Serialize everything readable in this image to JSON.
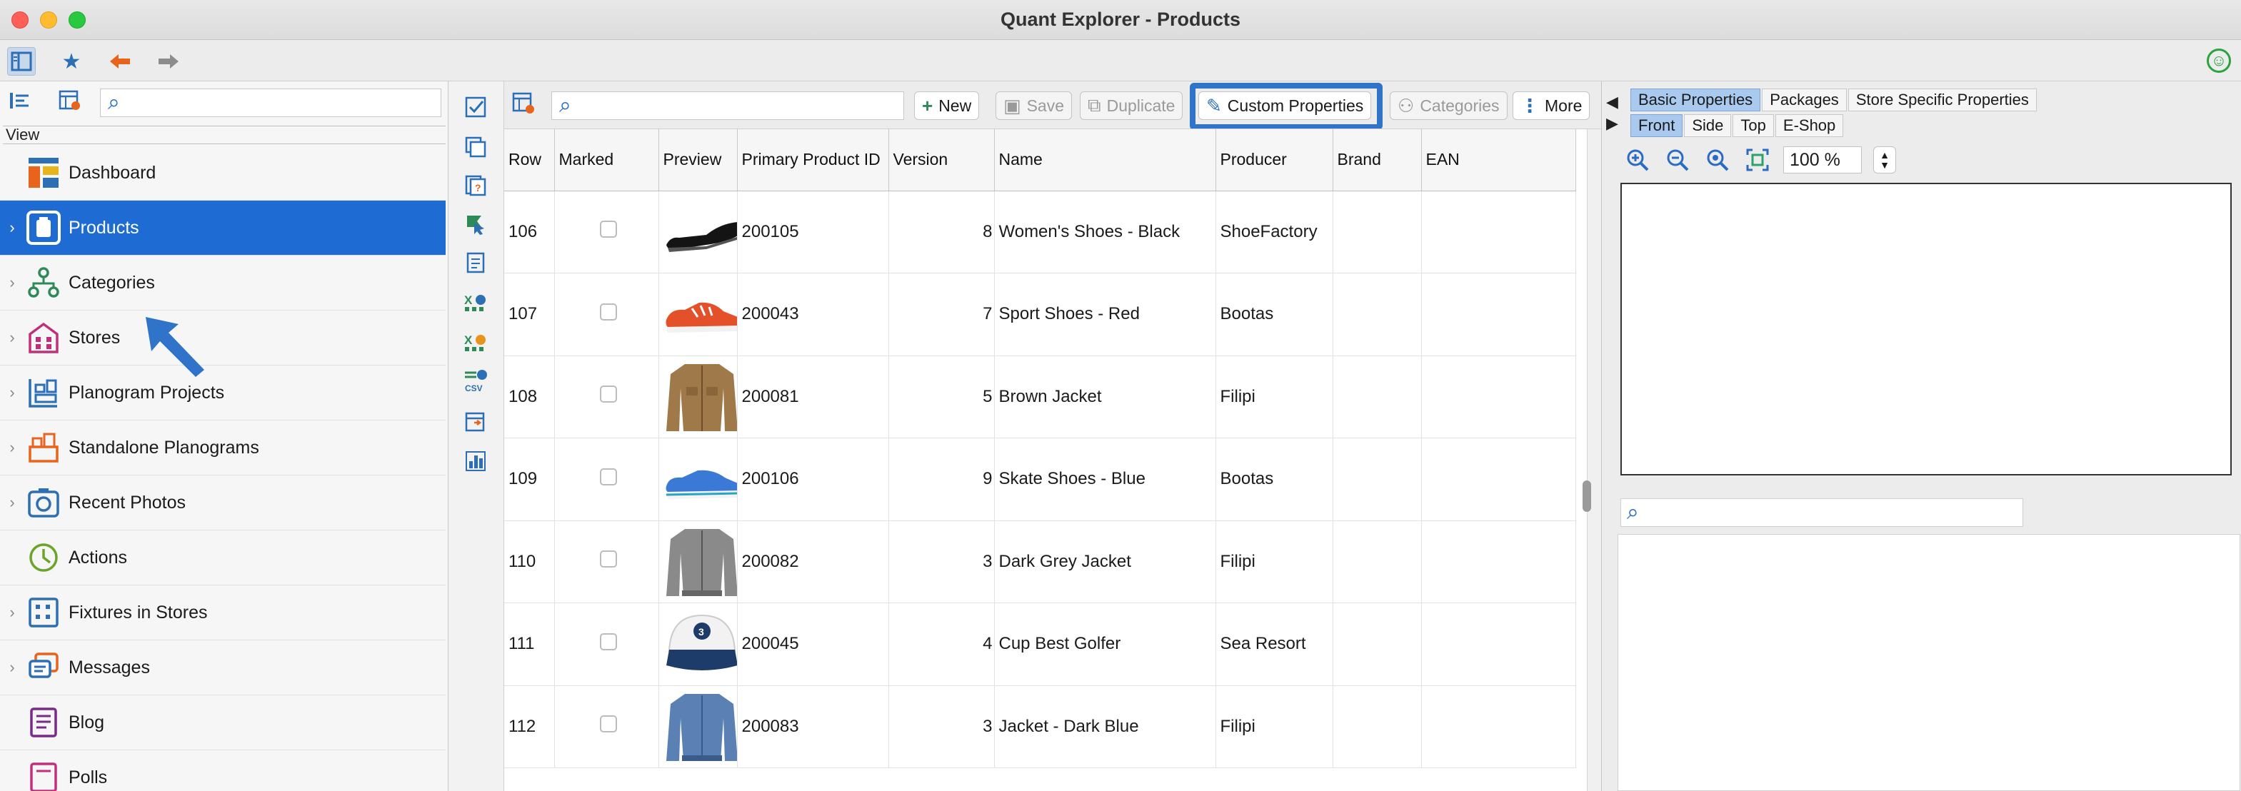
{
  "window": {
    "title": "Quant Explorer - Products"
  },
  "toolbar": {
    "icons": [
      "sidebar-toggle-icon",
      "star-icon",
      "back-arrow-icon",
      "forward-arrow-icon",
      "smiley-icon"
    ]
  },
  "nav": {
    "search_placeholder": "",
    "view_label": "View",
    "items": [
      {
        "label": "Dashboard",
        "icon": "dashboard-icon",
        "expandable": false,
        "selected": false,
        "color": "#e0622a"
      },
      {
        "label": "Products",
        "icon": "products-icon",
        "expandable": true,
        "selected": true,
        "color": "#ffffff"
      },
      {
        "label": "Categories",
        "icon": "categories-icon",
        "expandable": true,
        "selected": false,
        "color": "#2e8b57"
      },
      {
        "label": "Stores",
        "icon": "stores-icon",
        "expandable": true,
        "selected": false,
        "color": "#c0307a"
      },
      {
        "label": "Planogram Projects",
        "icon": "planogram-projects-icon",
        "expandable": true,
        "selected": false,
        "color": "#2c6fb5"
      },
      {
        "label": "Standalone Planograms",
        "icon": "standalone-planograms-icon",
        "expandable": true,
        "selected": false,
        "color": "#e0622a"
      },
      {
        "label": "Recent Photos",
        "icon": "camera-icon",
        "expandable": true,
        "selected": false,
        "color": "#2c6fb5"
      },
      {
        "label": "Actions",
        "icon": "actions-icon",
        "expandable": false,
        "selected": false,
        "color": "#6aa52a"
      },
      {
        "label": "Fixtures in Stores",
        "icon": "fixtures-icon",
        "expandable": true,
        "selected": false,
        "color": "#2c6fb5"
      },
      {
        "label": "Messages",
        "icon": "messages-icon",
        "expandable": true,
        "selected": false,
        "color": "#e0622a"
      },
      {
        "label": "Blog",
        "icon": "blog-icon",
        "expandable": false,
        "selected": false,
        "color": "#8a2a8a"
      },
      {
        "label": "Polls",
        "icon": "polls-icon",
        "expandable": false,
        "selected": false,
        "color": "#c0307a"
      }
    ]
  },
  "center": {
    "search_placeholder": "",
    "buttons": {
      "new": "New",
      "save": "Save",
      "duplicate": "Duplicate",
      "custom_properties": "Custom Properties",
      "categories": "Categories",
      "more": "More"
    },
    "columns": [
      "Row",
      "Marked",
      "Preview",
      "Primary Product ID",
      "Version",
      "Name",
      "Producer",
      "Brand",
      "EAN"
    ],
    "rows": [
      {
        "row": "106",
        "id": "200105",
        "version": "8",
        "name": "Women's Shoes - Black",
        "producer": "ShoeFactory",
        "brand": "",
        "ean": "",
        "preview": "black-shoe"
      },
      {
        "row": "107",
        "id": "200043",
        "version": "7",
        "name": "Sport Shoes - Red",
        "producer": "Bootas",
        "brand": "",
        "ean": "",
        "preview": "red-shoe"
      },
      {
        "row": "108",
        "id": "200081",
        "version": "5",
        "name": "Brown Jacket",
        "producer": "Filipi",
        "brand": "",
        "ean": "",
        "preview": "brown-jacket"
      },
      {
        "row": "109",
        "id": "200106",
        "version": "9",
        "name": "Skate Shoes - Blue",
        "producer": "Bootas",
        "brand": "",
        "ean": "",
        "preview": "blue-shoe"
      },
      {
        "row": "110",
        "id": "200082",
        "version": "3",
        "name": "Dark Grey Jacket",
        "producer": "Filipi",
        "brand": "",
        "ean": "",
        "preview": "grey-jacket"
      },
      {
        "row": "111",
        "id": "200045",
        "version": "4",
        "name": "Cup Best Golfer",
        "producer": "Sea Resort",
        "brand": "",
        "ean": "",
        "preview": "cap"
      },
      {
        "row": "112",
        "id": "200083",
        "version": "3",
        "name": "Jacket - Dark Blue",
        "producer": "Filipi",
        "brand": "",
        "ean": "",
        "preview": "blue-jacket"
      }
    ]
  },
  "right": {
    "tabs_top": [
      "Basic Properties",
      "Packages",
      "Store Specific Properties"
    ],
    "tabs_view": [
      "Front",
      "Side",
      "Top",
      "E-Shop"
    ],
    "zoom": "100 %",
    "search_placeholder": ""
  },
  "colors": {
    "accent": "#1f6bd4",
    "highlight": "#2f74c8",
    "tab_active": "#a9c9ee"
  }
}
